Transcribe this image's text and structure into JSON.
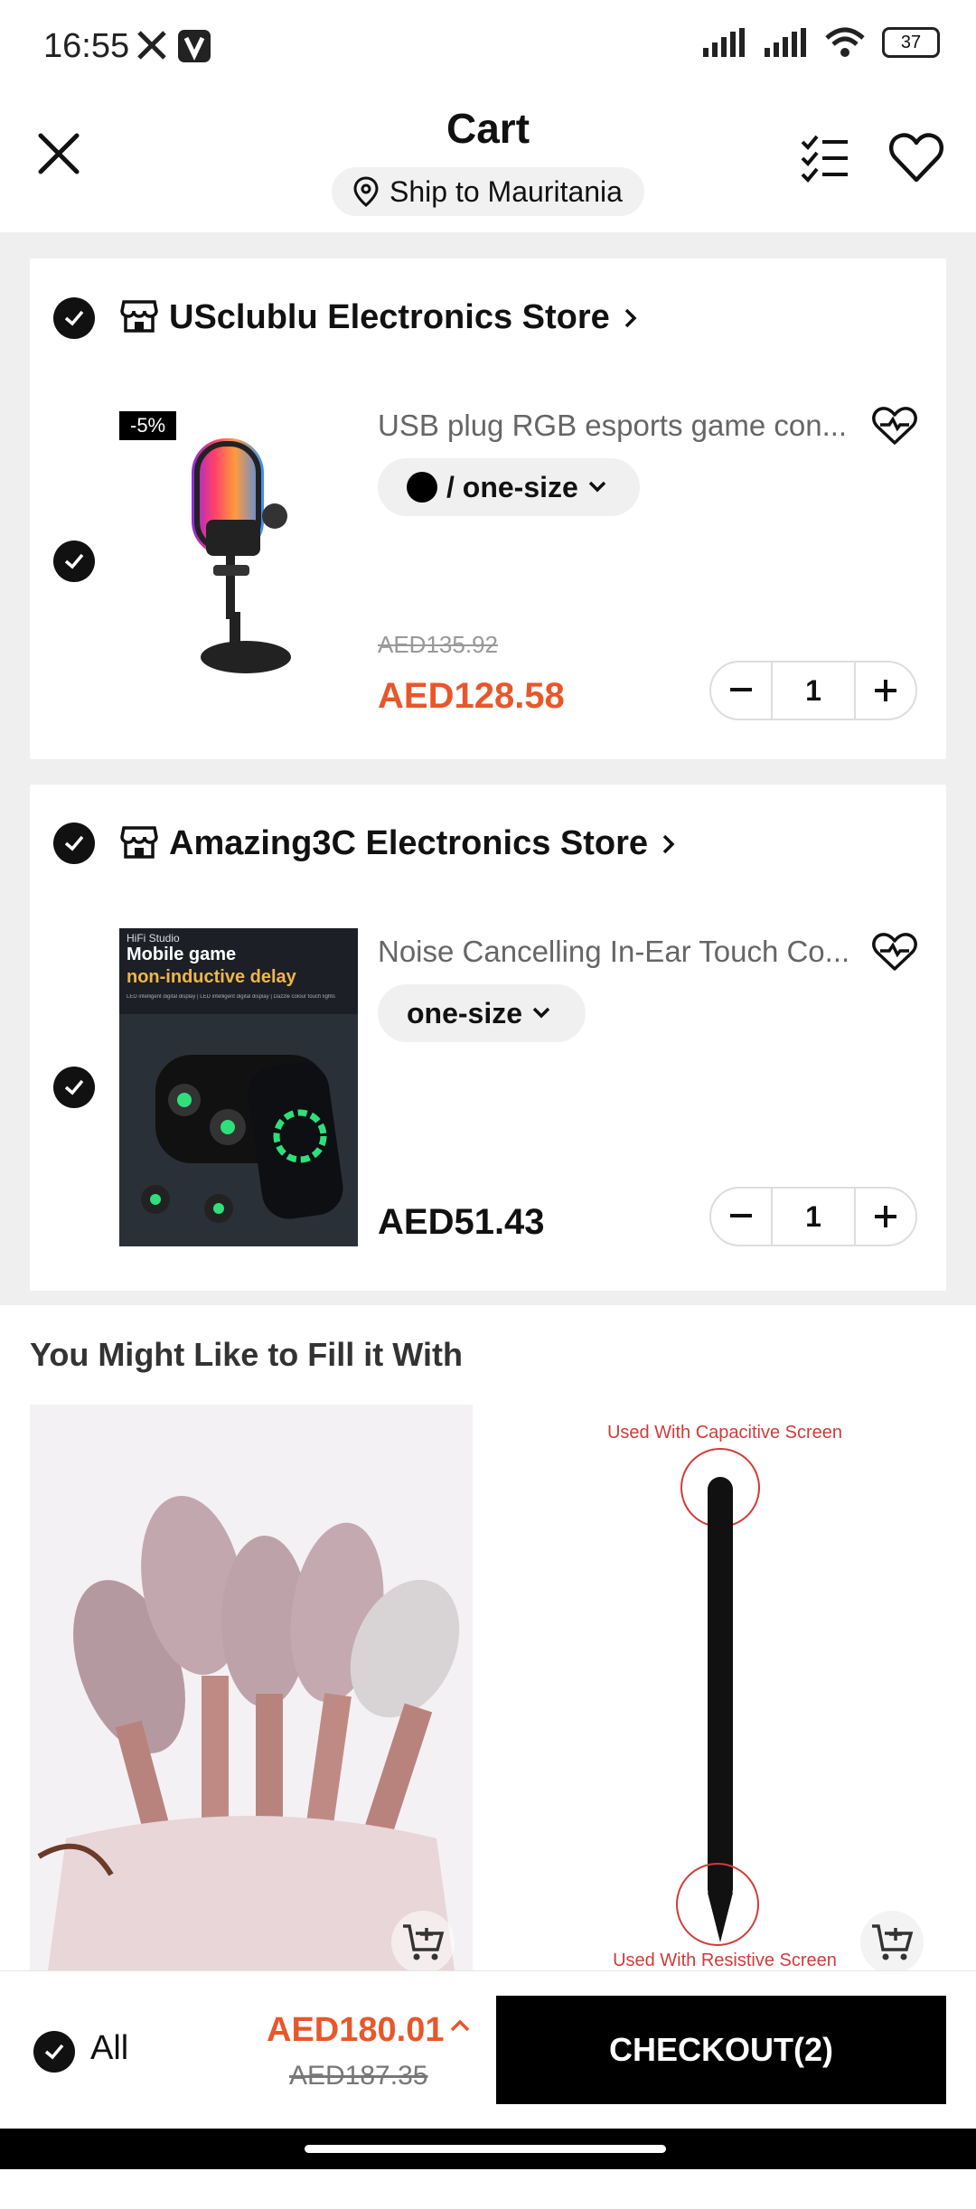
{
  "status_bar": {
    "time": "16:55",
    "battery": "37"
  },
  "header": {
    "title": "Cart",
    "ship_to": "Ship to Mauritania"
  },
  "stores": [
    {
      "name": "USclublu Electronics Store",
      "item": {
        "discount_badge": "-5%",
        "title": "USB plug RGB esports game con...",
        "variant": "/ one-size",
        "old_price": "AED135.92",
        "price": "AED128.58",
        "quantity": "1"
      }
    },
    {
      "name": "Amazing3C Electronics Store",
      "item": {
        "title": "Noise Cancelling In-Ear Touch Co...",
        "variant": "one-size",
        "price": "AED51.43",
        "quantity": "1",
        "image_text": {
          "brand": "HiFi Studio",
          "line1": "Mobile game",
          "line2": "non-inductive delay",
          "features": "LED intelligent digital display | LED intelligent digital display | Dazzle colour touch lights"
        }
      }
    }
  ],
  "recommendations": {
    "title": "You Might Like to Fill it With",
    "items": [
      {
        "image": "makeup-brush-set"
      },
      {
        "image": "stylus-pen",
        "top_text": "Used With Capacitive Screen",
        "bottom_text": "Used With Resistive Screen"
      }
    ]
  },
  "bottom_bar": {
    "all_label": "All",
    "total": "AED180.01",
    "old_total": "AED187.35",
    "checkout_label": "CHECKOUT(2)"
  },
  "colors": {
    "accent": "#e8572a",
    "checkout_bg": "#000000"
  }
}
